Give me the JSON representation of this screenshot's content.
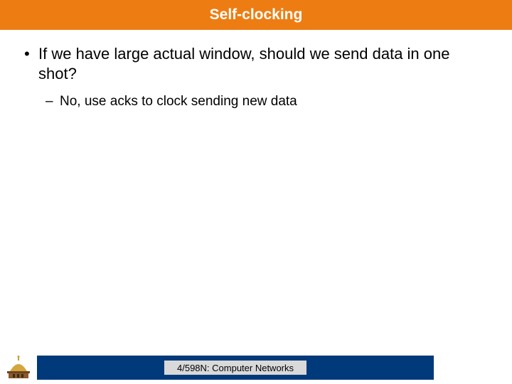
{
  "title": "Self-clocking",
  "bullets": [
    {
      "text": "If we have large actual window, should we send data in one shot?",
      "sub": [
        "No, use acks to clock sending new data"
      ]
    }
  ],
  "footer": {
    "label": "4/598N: Computer Networks",
    "logo_name": "dome-icon"
  },
  "colors": {
    "accent_orange": "#ed7d12",
    "footer_navy": "#003a7a",
    "footer_label_bg": "#d9d9d9"
  }
}
